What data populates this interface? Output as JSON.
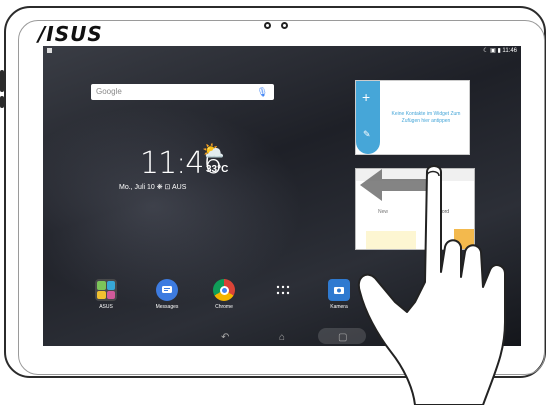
{
  "device": {
    "brand_logo": "/ISUS"
  },
  "statusbar": {
    "time": "11:46",
    "icons_text": "☾ ▣ ▮"
  },
  "search": {
    "label": "Google",
    "mic_icon": "mic-icon"
  },
  "clock_widget": {
    "time": "11:46",
    "temperature": "33°C",
    "date_line": "Mo., Juli 10 ❋ ⊡ AUS",
    "weather_icon": "partly-cloudy-icon"
  },
  "dock": {
    "apps": [
      {
        "label": "ASUS",
        "icon": "folder-icon"
      },
      {
        "label": "Messages",
        "icon": "messages-icon"
      },
      {
        "label": "Chrome",
        "icon": "chrome-icon"
      },
      {
        "label": "",
        "icon": "app-drawer-icon"
      },
      {
        "label": "Kamera",
        "icon": "camera-icon"
      }
    ]
  },
  "navbar": {
    "back_icon": "back-icon",
    "home_icon": "home-icon",
    "recents_icon": "recents-icon"
  },
  "contacts_widget": {
    "text": "Keine Kontakte im Widget Zum Zufügen hier antippen",
    "add_icon": "plus-icon",
    "edit_icon": "edit-icon"
  },
  "preview_card": {
    "left_text": "New",
    "right_text": "ng Record"
  },
  "gesture": {
    "type": "swipe-left",
    "icon": "swipe-left-arrow-icon"
  },
  "colors": {
    "widget_accent": "#46a6d8",
    "messages": "#3d7be0",
    "camera": "#2f7ad0"
  }
}
